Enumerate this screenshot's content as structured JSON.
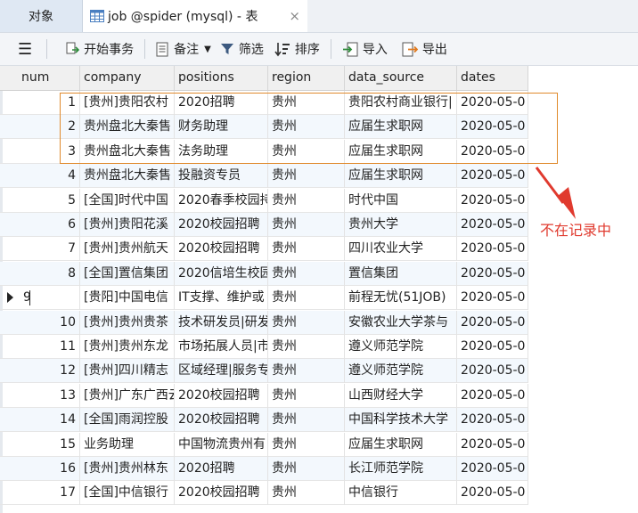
{
  "tabs": {
    "object_label": "对象",
    "table_label": "job @spider (mysql) - 表",
    "close_glyph": "×"
  },
  "toolbar": {
    "menu_glyph": "☰",
    "begin_transaction": "开始事务",
    "memo": "备注",
    "filter": "筛选",
    "sort": "排序",
    "import": "导入",
    "export": "导出"
  },
  "table": {
    "columns": [
      "num",
      "company",
      "positions",
      "region",
      "data_source",
      "dates"
    ],
    "rows": [
      {
        "num": "1",
        "company": "[贵州]贵阳农村",
        "positions": "2020招聘",
        "region": "贵州",
        "data_source": "贵阳农村商业银行|",
        "dates": "2020-05-0"
      },
      {
        "num": "2",
        "company": "贵州盘北大秦售",
        "positions": "财务助理",
        "region": "贵州",
        "data_source": "应届生求职网",
        "dates": "2020-05-0"
      },
      {
        "num": "3",
        "company": "贵州盘北大秦售",
        "positions": "法务助理",
        "region": "贵州",
        "data_source": "应届生求职网",
        "dates": "2020-05-0"
      },
      {
        "num": "4",
        "company": "贵州盘北大秦售",
        "positions": "投融资专员",
        "region": "贵州",
        "data_source": "应届生求职网",
        "dates": "2020-05-0"
      },
      {
        "num": "5",
        "company": "[全国]时代中国",
        "positions": "2020春季校园持",
        "region": "贵州",
        "data_source": "时代中国",
        "dates": "2020-05-0"
      },
      {
        "num": "6",
        "company": "[贵州]贵阳花溪",
        "positions": "2020校园招聘",
        "region": "贵州",
        "data_source": "贵州大学",
        "dates": "2020-05-0"
      },
      {
        "num": "7",
        "company": "[贵州]贵州航天",
        "positions": "2020校园招聘",
        "region": "贵州",
        "data_source": "四川农业大学",
        "dates": "2020-05-0"
      },
      {
        "num": "8",
        "company": "[全国]置信集团",
        "positions": "2020信培生校园",
        "region": "贵州",
        "data_source": "置信集团",
        "dates": "2020-05-0"
      },
      {
        "num": "9",
        "company": "[贵阳]中国电信",
        "positions": "IT支撑、维护或",
        "region": "贵州",
        "data_source": "前程无忧(51JOB)",
        "dates": "2020-05-0"
      },
      {
        "num": "10",
        "company": "[贵州]贵州贵茶",
        "positions": "技术研发员|研发",
        "region": "贵州",
        "data_source": "安徽农业大学茶与",
        "dates": "2020-05-0"
      },
      {
        "num": "11",
        "company": "[贵州]贵州东龙",
        "positions": "市场拓展人员|市",
        "region": "贵州",
        "data_source": "遵义师范学院",
        "dates": "2020-05-0"
      },
      {
        "num": "12",
        "company": "[贵州]四川精志",
        "positions": "区域经理|服务专",
        "region": "贵州",
        "data_source": "遵义师范学院",
        "dates": "2020-05-0"
      },
      {
        "num": "13",
        "company": "[贵州]广东广西云",
        "positions": "2020校园招聘",
        "region": "贵州",
        "data_source": "山西财经大学",
        "dates": "2020-05-0"
      },
      {
        "num": "14",
        "company": "[全国]雨润控股",
        "positions": "2020校园招聘",
        "region": "贵州",
        "data_source": "中国科学技术大学",
        "dates": "2020-05-0"
      },
      {
        "num": "15",
        "company": "业务助理",
        "positions": "中国物流贵州有",
        "region": "贵州",
        "data_source": "应届生求职网",
        "dates": "2020-05-0"
      },
      {
        "num": "16",
        "company": "[贵州]贵州林东",
        "positions": "2020招聘",
        "region": "贵州",
        "data_source": "长江师范学院",
        "dates": "2020-05-0"
      },
      {
        "num": "17",
        "company": "[全国]中信银行",
        "positions": "2020校园招聘",
        "region": "贵州",
        "data_source": "中信银行",
        "dates": "2020-05-0"
      }
    ],
    "current_row_num": "9"
  },
  "annotation": {
    "note_text": "不在记录中",
    "color": "#e03a2e"
  }
}
